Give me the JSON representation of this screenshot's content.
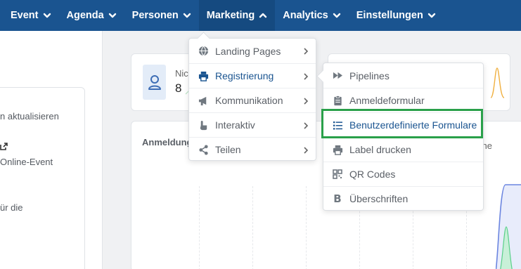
{
  "topnav": {
    "items": [
      {
        "label": "Event"
      },
      {
        "label": "Agenda"
      },
      {
        "label": "Personen"
      },
      {
        "label": "Marketing"
      },
      {
        "label": "Analytics"
      },
      {
        "label": "Einstellungen"
      }
    ],
    "active_color": "#154a80",
    "bar_color": "#1a5490"
  },
  "leftpanel": {
    "line1": "n aktualisieren",
    "line2": "Online-Event",
    "line3": "ür die"
  },
  "stat_card": {
    "label": "Nic",
    "value": "8"
  },
  "chart_card": {
    "title": "Anmeldung",
    "title_right": "che"
  },
  "marketing_menu": {
    "items": [
      {
        "label": "Landing Pages",
        "icon": "globe-icon"
      },
      {
        "label": "Registrierung",
        "icon": "printer-icon"
      },
      {
        "label": "Kommunikation",
        "icon": "megaphone-icon"
      },
      {
        "label": "Interaktiv",
        "icon": "pointer-hand-icon"
      },
      {
        "label": "Teilen",
        "icon": "share-icon"
      }
    ]
  },
  "registrierung_menu": {
    "items": [
      {
        "label": "Pipelines",
        "icon": "fast-forward-icon"
      },
      {
        "label": "Anmeldeformular",
        "icon": "clipboard-icon"
      },
      {
        "label": "Benutzerdefinierte Formulare",
        "icon": "list-icon"
      },
      {
        "label": "Label drucken",
        "icon": "printer-icon"
      },
      {
        "label": "QR Codes",
        "icon": "qrcode-icon"
      },
      {
        "label": "Überschriften",
        "icon": "bold-icon"
      }
    ],
    "highlight_color": "#2aa04a"
  }
}
